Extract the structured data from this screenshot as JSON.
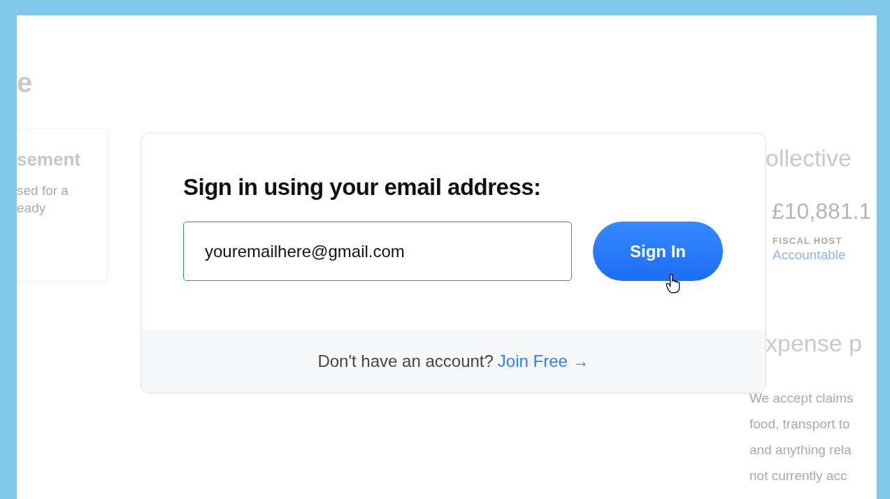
{
  "background": {
    "left": {
      "heading": "e",
      "card_title": "sement",
      "card_lines": [
        "sed for a",
        "eady"
      ]
    },
    "right": {
      "heading": "ollective",
      "amount": "£10,881.1",
      "host_label": "FISCAL HOST",
      "host_name": "Accountable",
      "section_heading": "xpense p",
      "paragraph_lines": [
        "We accept claims",
        "food, transport to",
        "and anything rela",
        "not currently acc"
      ]
    }
  },
  "modal": {
    "title": "Sign in using your email address:",
    "email": {
      "value": "youremailhere@gmail.com"
    },
    "button": "Sign In",
    "footer_text": "Don't have an account?",
    "footer_link": "Join Free →"
  }
}
